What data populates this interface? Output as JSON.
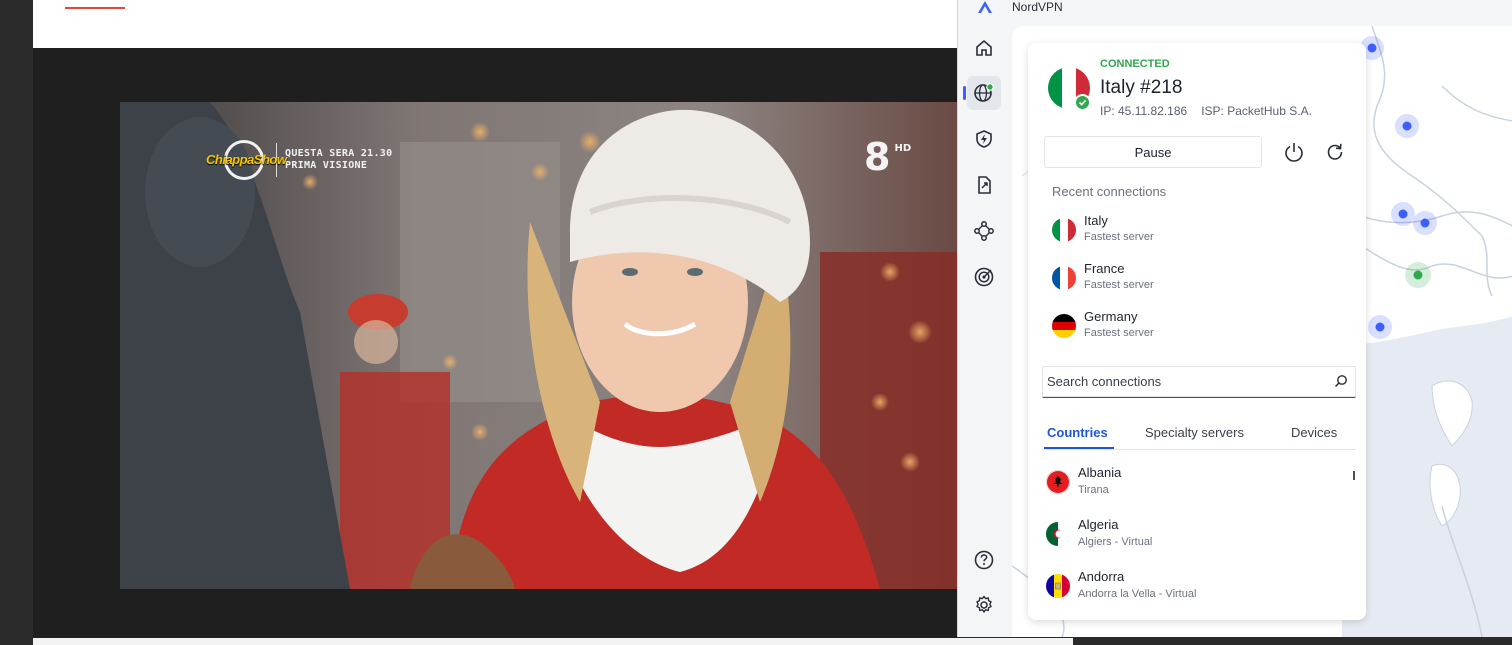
{
  "app": {
    "title": "NordVPN"
  },
  "video": {
    "overlay_line1": "QUESTA SERA 21.30",
    "overlay_line2": "PRIMA VISIONE",
    "show_logo_text": "ChiappaShow",
    "channel_number": "8",
    "channel_hd": "HD"
  },
  "sidebar": {
    "items": [
      {
        "name": "home",
        "icon": "home-icon"
      },
      {
        "name": "countries",
        "icon": "globe-icon",
        "active": true
      },
      {
        "name": "threat-protection",
        "icon": "shield-bolt-icon"
      },
      {
        "name": "file-share",
        "icon": "file-share-icon"
      },
      {
        "name": "meshnet",
        "icon": "meshnet-icon"
      },
      {
        "name": "dark-web-monitor",
        "icon": "target-icon"
      }
    ],
    "bottom": [
      {
        "name": "help",
        "icon": "help-icon"
      },
      {
        "name": "settings",
        "icon": "gear-icon"
      }
    ]
  },
  "connection": {
    "status": "CONNECTED",
    "server": "Italy #218",
    "ip": "IP: 45.11.82.186",
    "isp": "ISP: PacketHub S.A.",
    "pause_label": "Pause"
  },
  "recent": {
    "heading": "Recent connections",
    "items": [
      {
        "name": "Italy",
        "sub": "Fastest server",
        "flag": [
          "#009246",
          "#ffffff",
          "#ce2b37"
        ]
      },
      {
        "name": "France",
        "sub": "Fastest server",
        "flag": [
          "#0055a4",
          "#ffffff",
          "#ef4135"
        ]
      },
      {
        "name": "Germany",
        "sub": "Fastest server",
        "flag": [
          "#000000",
          "#dd0000",
          "#ffce00"
        ]
      }
    ]
  },
  "search": {
    "placeholder": "Search connections"
  },
  "tabs": [
    {
      "label": "Countries",
      "active": true
    },
    {
      "label": "Specialty servers"
    },
    {
      "label": "Devices"
    }
  ],
  "countries": [
    {
      "name": "Albania",
      "sub": "Tirana",
      "flag_color": "#e41e20"
    },
    {
      "name": "Algeria",
      "sub": "Algiers - Virtual",
      "flag": [
        "#006233",
        "#ffffff"
      ]
    },
    {
      "name": "Andorra",
      "sub": "Andorra la Vella - Virtual",
      "flag": [
        "#10069f",
        "#fedf00",
        "#d50032"
      ]
    }
  ],
  "colors": {
    "accent": "#1e56d8",
    "connected": "#2fa84f",
    "map_water": "#e6ebf3",
    "map_land": "#ffffff",
    "server_dot": "#3e5fff"
  }
}
